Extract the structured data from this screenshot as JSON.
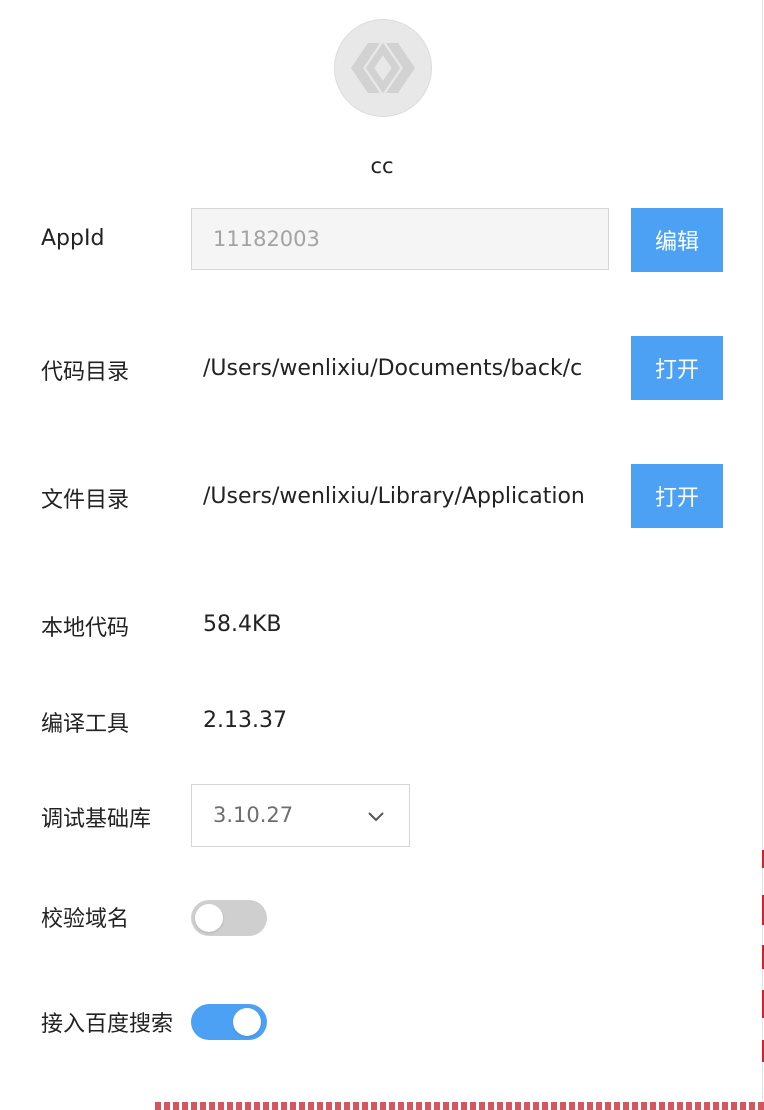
{
  "app": {
    "name": "cc",
    "logo_icon": "app-logo-icon"
  },
  "appid": {
    "label": "AppId",
    "value": "11182003",
    "button_label": "编辑"
  },
  "code_dir": {
    "label": "代码目录",
    "path": "/Users/wenlixiu/Documents/back/c",
    "button_label": "打开"
  },
  "file_dir": {
    "label": "文件目录",
    "path": "/Users/wenlixiu/Library/Application",
    "button_label": "打开"
  },
  "local_code": {
    "label": "本地代码",
    "value": "58.4KB"
  },
  "compiler": {
    "label": "编译工具",
    "value": "2.13.37"
  },
  "debug_lib": {
    "label": "调试基础库",
    "selected": "3.10.27",
    "chevron_icon": "chevron-down-icon"
  },
  "verify_domain": {
    "label": "校验域名",
    "enabled": false
  },
  "baidu_search": {
    "label": "接入百度搜索",
    "enabled": true
  },
  "colors": {
    "accent": "#4da1f5",
    "toggle_off": "#cfcfcf",
    "border": "#d6d6d6"
  }
}
